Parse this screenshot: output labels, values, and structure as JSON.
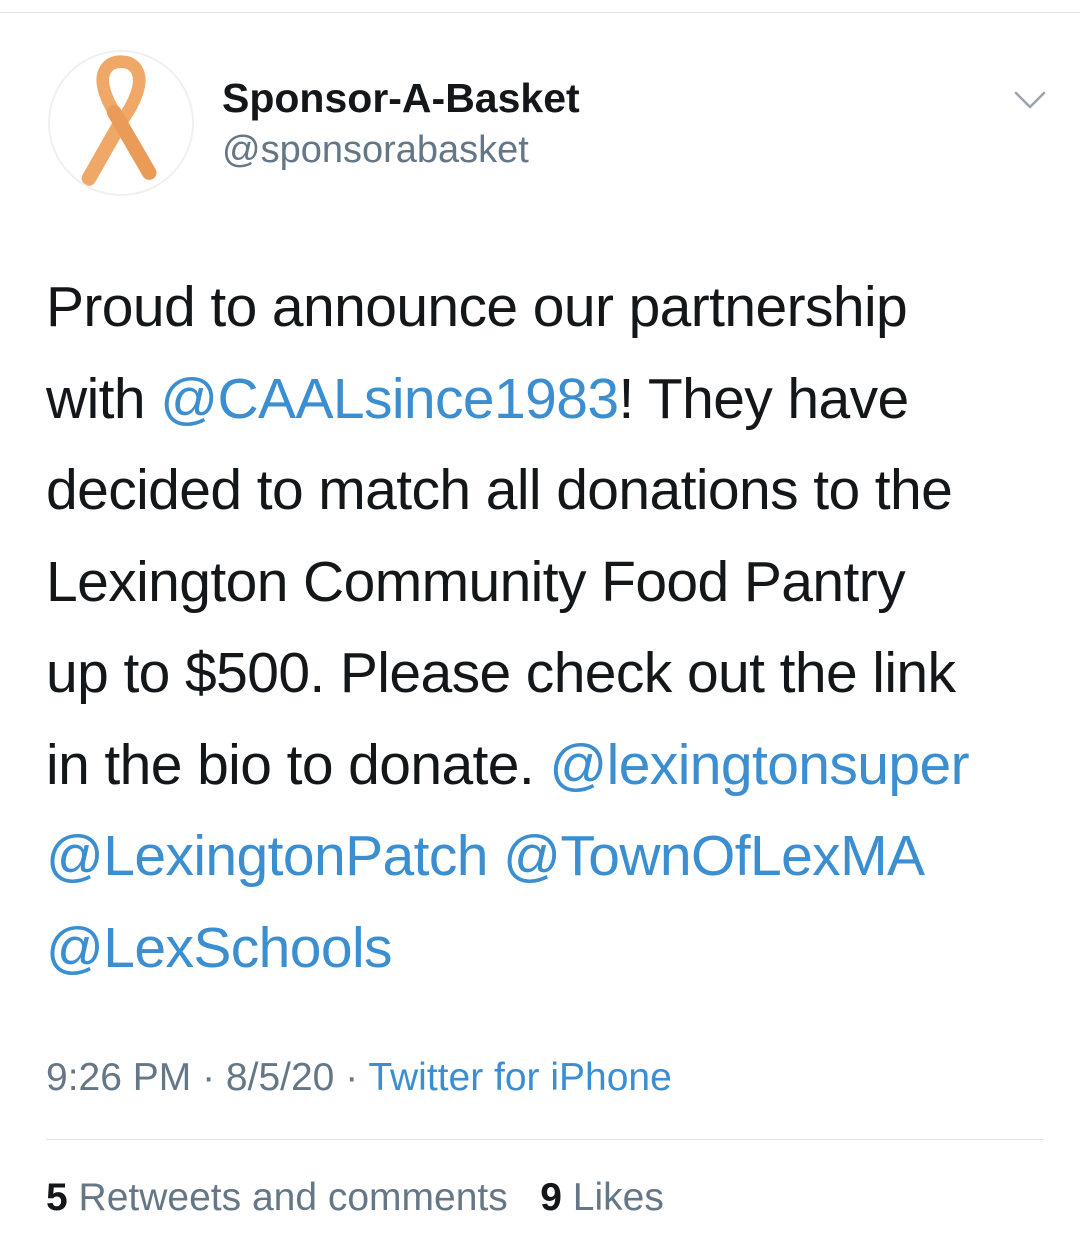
{
  "account": {
    "display_name": "Sponsor-A-Basket",
    "handle": "@sponsorabasket",
    "avatar_icon": "orange-ribbon-icon",
    "ribbon_color": "#f0a868"
  },
  "menu_icon": "chevron-down-icon",
  "tweet": {
    "lines": [
      [
        {
          "text": "Proud to announce our partnership",
          "type": "text"
        }
      ],
      [
        {
          "text": "with ",
          "type": "text"
        },
        {
          "text": "@CAALsince1983",
          "type": "mention"
        },
        {
          "text": "! They have",
          "type": "text"
        }
      ],
      [
        {
          "text": "decided to match all donations to the",
          "type": "text"
        }
      ],
      [
        {
          "text": "Lexington Community Food Pantry",
          "type": "text"
        }
      ],
      [
        {
          "text": "up to $500. Please check out the link",
          "type": "text"
        }
      ],
      [
        {
          "text": "in the bio to donate. ",
          "type": "text"
        },
        {
          "text": "@lexingtonsuper",
          "type": "mention"
        }
      ],
      [
        {
          "text": "@LexingtonPatch",
          "type": "mention"
        },
        {
          "text": " ",
          "type": "text"
        },
        {
          "text": "@TownOfLexMA",
          "type": "mention"
        }
      ],
      [
        {
          "text": "@LexSchools",
          "type": "mention"
        }
      ]
    ]
  },
  "meta": {
    "time": "9:26 PM",
    "separator": " · ",
    "date": "8/5/20",
    "source": "Twitter for iPhone"
  },
  "stats": {
    "retweets_count": "5",
    "retweets_label": " Retweets and comments",
    "likes_count": "9",
    "likes_label": " Likes"
  },
  "colors": {
    "link": "#3b8ed0",
    "secondary_text": "#657786",
    "primary_text": "#14171a"
  }
}
